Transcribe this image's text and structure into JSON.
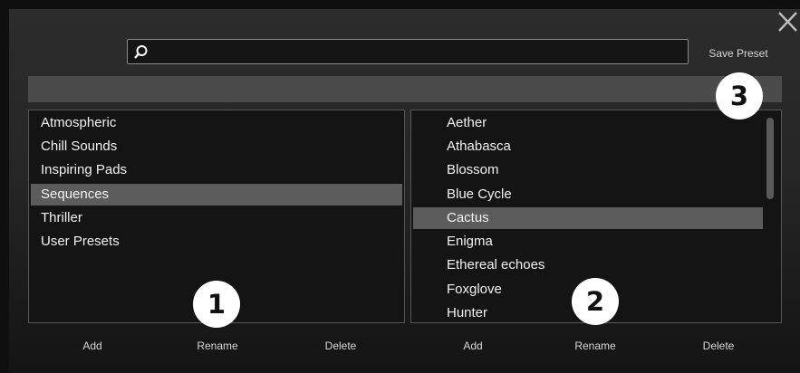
{
  "window": {
    "close_icon": "close-icon"
  },
  "search": {
    "value": "",
    "placeholder": "",
    "icon": "search-icon"
  },
  "save_preset_label": "Save Preset",
  "categories": {
    "items": [
      {
        "label": "Atmospheric",
        "selected": false
      },
      {
        "label": "Chill Sounds",
        "selected": false
      },
      {
        "label": "Inspiring Pads",
        "selected": false
      },
      {
        "label": "Sequences",
        "selected": true
      },
      {
        "label": "Thriller",
        "selected": false
      },
      {
        "label": "User Presets",
        "selected": false
      }
    ],
    "buttons": {
      "add": "Add",
      "rename": "Rename",
      "delete": "Delete"
    }
  },
  "presets": {
    "items": [
      {
        "label": "Aether",
        "selected": false
      },
      {
        "label": "Athabasca",
        "selected": false
      },
      {
        "label": "Blossom",
        "selected": false
      },
      {
        "label": "Blue Cycle",
        "selected": false
      },
      {
        "label": "Cactus",
        "selected": true
      },
      {
        "label": "Enigma",
        "selected": false
      },
      {
        "label": "Ethereal echoes",
        "selected": false
      },
      {
        "label": "Foxglove",
        "selected": false
      },
      {
        "label": "Hunter",
        "selected": false
      }
    ],
    "buttons": {
      "add": "Add",
      "rename": "Rename",
      "delete": "Delete"
    }
  },
  "callouts": [
    "1",
    "2",
    "3"
  ],
  "colors": {
    "selection": "#5c5c5c",
    "callout_bg": "#ffffff"
  }
}
